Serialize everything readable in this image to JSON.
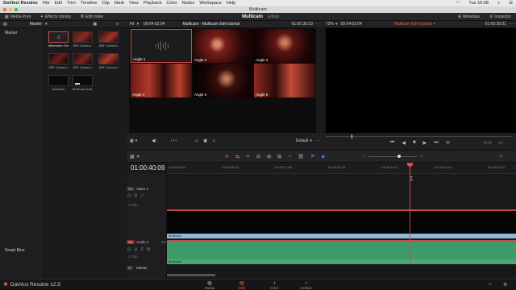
{
  "menubar": {
    "items": [
      "DaVinci Resolve",
      "File",
      "Edit",
      "Trim",
      "Timeline",
      "Clip",
      "Mark",
      "View",
      "Playback",
      "Color",
      "Nodes",
      "Workspace",
      "Help"
    ],
    "clock": "Tue 15:08"
  },
  "window": {
    "title": "Multicam"
  },
  "toolbar": {
    "media_pool": "Media Pool",
    "effects_library": "Effects Library",
    "edit_index": "Edit Index",
    "project_title": "Multicam",
    "edited": "Edited",
    "metadata": "Metadata",
    "inspector": "Inspector"
  },
  "bins": {
    "header": "Master",
    "items": [
      "Master"
    ],
    "smart_bins": "Smart Bins"
  },
  "clips": [
    {
      "label": "Miserable Gro..."
    },
    {
      "label": "JBR Camera 1"
    },
    {
      "label": "JBR Camera 2"
    },
    {
      "label": "JBR Camera 3"
    },
    {
      "label": "JBR Camera 4"
    },
    {
      "label": "JBR Camera 10"
    },
    {
      "label": "Multicam"
    },
    {
      "label": "Multicam Edit ..."
    }
  ],
  "source_viewer": {
    "fit": "Fit",
    "timecode_left": "00:04:02:04",
    "title": "Multicam - Multicam Edit tutorial",
    "timecode_right": "01:00:35:23",
    "angles": [
      "Angle 1",
      "Angle 2",
      "Angle 3",
      "Angle 4",
      "Angle 5",
      "Angle 6"
    ],
    "default_label": "Default"
  },
  "program_viewer": {
    "zoom": "72%",
    "timecode_left": "00:04:02:04",
    "title": "Multicam Edit tutorial",
    "timecode_right": "01:00:35:01"
  },
  "timeline": {
    "timecode": "01:00:40:09",
    "ruler": [
      "01:00:00:00",
      "01:00:08:22",
      "01:00:17:20",
      "01:00:26:15",
      "01:00:35:17",
      "01:00:44:15",
      "01:00:52:12"
    ],
    "tracks": {
      "video1_tag": "V1",
      "video1_name": "Video 1",
      "video_clip_count": "1 Clip",
      "audio1_tag": "A1",
      "audio1_name": "Audio 1",
      "audio_channels": "2.0",
      "audio_clip_count": "1 Clip",
      "master": "Master"
    },
    "video_clip_label": "Multicam",
    "audio_clip_label": "Multicam"
  },
  "pages": [
    {
      "label": "Media",
      "icon": "media-icon"
    },
    {
      "label": "Edit",
      "icon": "edit-icon"
    },
    {
      "label": "Color",
      "icon": "color-icon"
    },
    {
      "label": "Deliver",
      "icon": "deliver-icon"
    }
  ],
  "brand": "DaVinci Resolve 12.5",
  "colors": {
    "accent": "#e06a3a",
    "playhead": "#e04b4b",
    "video_clip": "#8fb7d8",
    "audio_clip": "#3f9a6a",
    "selected_clip": "#c94a4a"
  }
}
